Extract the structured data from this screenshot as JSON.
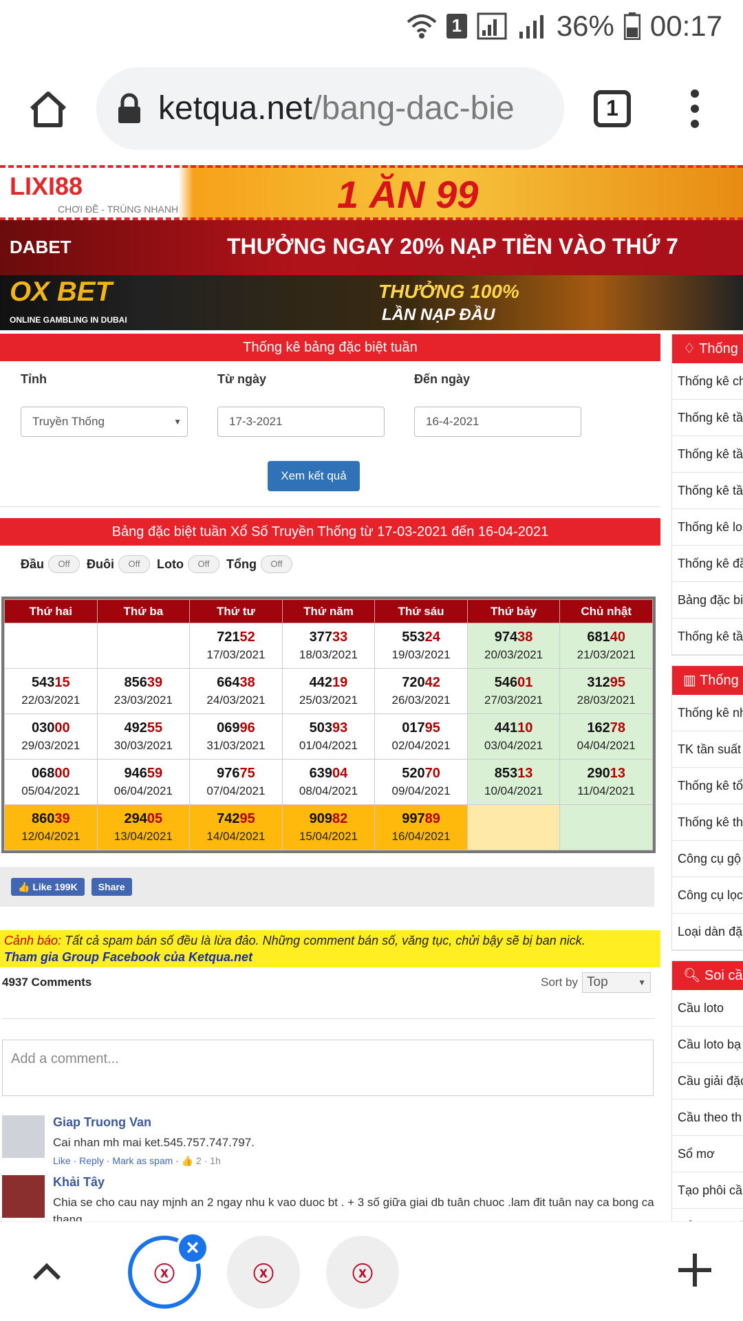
{
  "status": {
    "battery": "36%",
    "time": "00:17",
    "sim": "1"
  },
  "browser": {
    "url_host": "ketqua.net",
    "url_path": "/bang-dac-bie",
    "tab_count": "1"
  },
  "banners": {
    "b1_logo": "LIXI88",
    "b1_tagline": "CHƠI ĐỀ - TRÚNG NHANH",
    "b1_text": "1 ĂN 99",
    "b2_logo": "DABET",
    "b2_text": "THƯỞNG NGAY 20% NẠP TIỀN VÀO THỨ 7",
    "b3_logo": "OX BET",
    "b3_sub": "ONLINE GAMBLING IN DUBAI",
    "b3_text1": "THƯỞNG 100%",
    "b3_text2": "LẦN NẠP ĐẦU"
  },
  "form": {
    "title": "Thống kê bảng đặc biệt tuần",
    "tinh_label": "Tỉnh",
    "tinh_value": "Truyền Thống",
    "from_label": "Từ ngày",
    "from_value": "17-3-2021",
    "to_label": "Đến ngày",
    "to_value": "16-4-2021",
    "submit": "Xem kết quả"
  },
  "result": {
    "title": "Bảng đặc biệt tuần Xổ Số Truyền Thống từ 17-03-2021 đến 16-04-2021",
    "toggles": [
      {
        "label": "Đầu",
        "state": "Off"
      },
      {
        "label": "Đuôi",
        "state": "Off"
      },
      {
        "label": "Loto",
        "state": "Off"
      },
      {
        "label": "Tổng",
        "state": "Off"
      }
    ],
    "headers": [
      "Thứ hai",
      "Thứ ba",
      "Thứ tư",
      "Thứ năm",
      "Thứ sáu",
      "Thứ bảy",
      "Chủ nhật"
    ],
    "rows": [
      [
        null,
        null,
        {
          "p": "721",
          "s": "52",
          "d": "17/03/2021"
        },
        {
          "p": "377",
          "s": "33",
          "d": "18/03/2021"
        },
        {
          "p": "553",
          "s": "24",
          "d": "19/03/2021"
        },
        {
          "p": "974",
          "s": "38",
          "d": "20/03/2021"
        },
        {
          "p": "681",
          "s": "40",
          "d": "21/03/2021"
        }
      ],
      [
        {
          "p": "543",
          "s": "15",
          "d": "22/03/2021"
        },
        {
          "p": "856",
          "s": "39",
          "d": "23/03/2021"
        },
        {
          "p": "664",
          "s": "38",
          "d": "24/03/2021"
        },
        {
          "p": "442",
          "s": "19",
          "d": "25/03/2021"
        },
        {
          "p": "720",
          "s": "42",
          "d": "26/03/2021"
        },
        {
          "p": "546",
          "s": "01",
          "d": "27/03/2021"
        },
        {
          "p": "312",
          "s": "95",
          "d": "28/03/2021"
        }
      ],
      [
        {
          "p": "030",
          "s": "00",
          "d": "29/03/2021"
        },
        {
          "p": "492",
          "s": "55",
          "d": "30/03/2021"
        },
        {
          "p": "069",
          "s": "96",
          "d": "31/03/2021"
        },
        {
          "p": "503",
          "s": "93",
          "d": "01/04/2021"
        },
        {
          "p": "017",
          "s": "95",
          "d": "02/04/2021"
        },
        {
          "p": "441",
          "s": "10",
          "d": "03/04/2021"
        },
        {
          "p": "162",
          "s": "78",
          "d": "04/04/2021"
        }
      ],
      [
        {
          "p": "068",
          "s": "00",
          "d": "05/04/2021"
        },
        {
          "p": "946",
          "s": "59",
          "d": "06/04/2021"
        },
        {
          "p": "976",
          "s": "75",
          "d": "07/04/2021"
        },
        {
          "p": "639",
          "s": "04",
          "d": "08/04/2021"
        },
        {
          "p": "520",
          "s": "70",
          "d": "09/04/2021"
        },
        {
          "p": "853",
          "s": "13",
          "d": "10/04/2021"
        },
        {
          "p": "290",
          "s": "13",
          "d": "11/04/2021"
        }
      ],
      [
        {
          "p": "860",
          "s": "39",
          "d": "12/04/2021"
        },
        {
          "p": "294",
          "s": "05",
          "d": "13/04/2021"
        },
        {
          "p": "742",
          "s": "95",
          "d": "14/04/2021"
        },
        {
          "p": "909",
          "s": "82",
          "d": "15/04/2021"
        },
        {
          "p": "997",
          "s": "89",
          "d": "16/04/2021"
        },
        null,
        null
      ]
    ]
  },
  "social": {
    "like": "Like 199K",
    "share": "Share"
  },
  "warning": {
    "prefix": "Cảnh báo:",
    "text": " Tất cả spam bán số đều là lừa đảo. Những comment bán số, văng tục, chửi bậy sẽ bị ban nick.",
    "link": "Tham gia Group Facebook của Ketqua.net"
  },
  "comments": {
    "count": "4937 Comments",
    "sort_label": "Sort by",
    "sort_value": "Top",
    "placeholder": "Add a comment...",
    "items": [
      {
        "name": "Giap Truong Van",
        "text": "Cai nhan mh mai ket.545.757.747.797.",
        "meta": "Like · Reply · Mark as spam · ",
        "likes": "2",
        "age": " · 1h"
      },
      {
        "name": "Khải Tây",
        "text": "Chia se cho cau nay mjnh an 2 ngay nhu k vao duoc bt . + 3 số giữa giai db tuân chuoc .lam đit tuân nay ca bong ca thang .",
        "meta": "",
        "likes": "",
        "age": ""
      }
    ]
  },
  "sidebar": {
    "box1_title": "Thống",
    "box1_items": [
      "Thống kê ch",
      "Thống kê tầ loto",
      "Thống kê tầ",
      "Thống kê tầ loto",
      "Thống kê lo",
      "Thống kê đầ",
      "Bảng đặc bi",
      "Thống kê tầ theo Đặc Bi"
    ],
    "box2_title": "Thống",
    "box2_items": [
      "Thống kê nh",
      "TK tần suất",
      "Thống kê tổ",
      "Thống kê th",
      "Công cụ gộ",
      "Công cụ lọc VIP",
      "Loại dàn đặ"
    ],
    "box3_title": "Soi cầ",
    "box3_items": [
      "Cầu loto",
      "Cầu loto bạ",
      "Cầu giải đặc",
      "Cầu theo th",
      "Sổ mơ",
      "Tạo phôi cầ",
      "Tổng hợp cầ"
    ]
  },
  "colors": {
    "red": "#e6222b",
    "header": "#a0050d",
    "weekend": "#daf0d5",
    "highlight": "#ffb80c",
    "button": "#2f72b7"
  }
}
